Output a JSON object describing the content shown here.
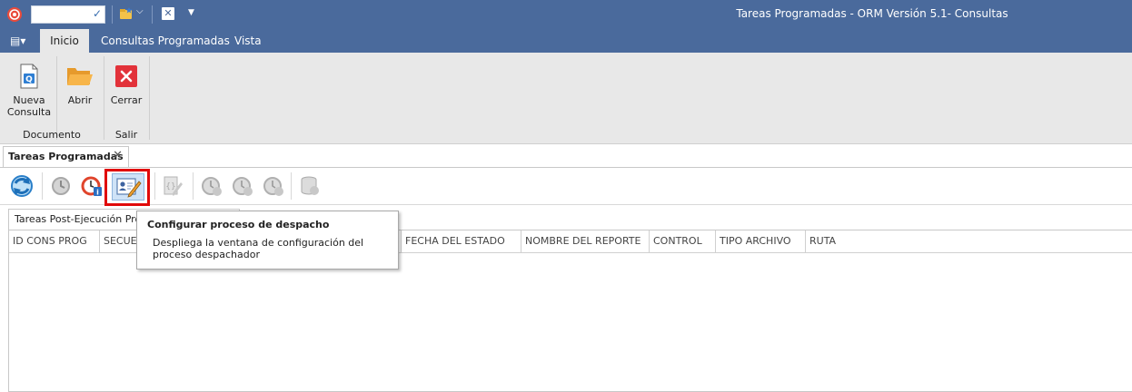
{
  "window": {
    "title": "Tareas Programadas - ORM Versión 5.1- Consultas"
  },
  "quick_access": {
    "combo_value": ""
  },
  "ribbon": {
    "tabs": [
      "Inicio",
      "Consultas Programadas",
      "Vista"
    ],
    "active_tab": "Inicio",
    "groups": [
      {
        "label": "Documento",
        "buttons": [
          {
            "label_line1": "Nueva",
            "label_line2": "Consulta"
          },
          {
            "label_line1": "Abrir",
            "label_line2": ""
          }
        ]
      },
      {
        "label": "Salir",
        "buttons": [
          {
            "label_line1": "Cerrar",
            "label_line2": ""
          }
        ]
      }
    ]
  },
  "document_tab": {
    "label": "Tareas Programadas"
  },
  "sub_tab": {
    "label": "Tareas Post-Ejecución Prog"
  },
  "grid": {
    "columns": [
      "ID CONS PROG",
      "SECUEN",
      "FECHA DEL ESTADO",
      "NOMBRE DEL REPORTE",
      "CONTROL",
      "TIPO ARCHIVO",
      "RUTA"
    ],
    "rows": []
  },
  "tooltip": {
    "title": "Configurar proceso de despacho",
    "description": "Despliega la ventana de configuración del proceso despachador"
  },
  "colors": {
    "titlebar": "#4a6a9c",
    "ribbon": "#e8e8e8",
    "highlight": "#e10a0a"
  }
}
